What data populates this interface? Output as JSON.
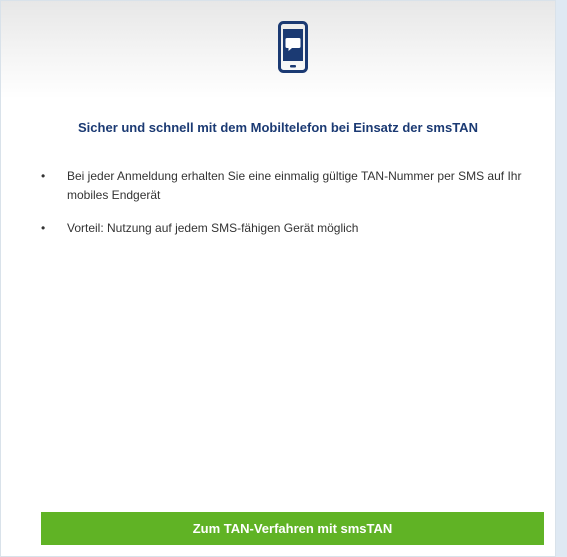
{
  "header": {
    "icon": "smartphone-message-icon",
    "icon_color": "#1b3a73"
  },
  "headline": "Sicher und schnell mit dem Mobiltelefon bei Einsatz der smsTAN",
  "benefits": [
    {
      "bullet": "•",
      "text": "Bei jeder Anmeldung erhalten Sie eine einmalig gültige TAN-Nummer per SMS auf Ihr mobiles Endgerät"
    },
    {
      "bullet": "•",
      "text": "Vorteil: Nutzung auf jedem SMS-fähigen Gerät möglich"
    }
  ],
  "cta": {
    "label": "Zum TAN-Verfahren mit smsTAN",
    "color": "#60b325"
  }
}
